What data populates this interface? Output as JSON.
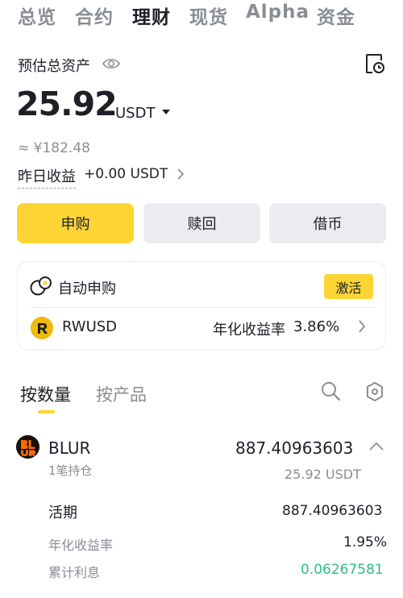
{
  "top_tabs": [
    {
      "label": "总览"
    },
    {
      "label": "合约"
    },
    {
      "label": "理财"
    },
    {
      "label": "现货"
    },
    {
      "label": "Alpha"
    },
    {
      "label": "资金"
    }
  ],
  "active_top_tab": "理财",
  "overview": {
    "label": "预估总资产",
    "balance": "25.92",
    "unit": "USDT",
    "fiat_estimate": "≈ ¥182.48",
    "yesterday_label": "昨日收益",
    "yesterday_value": "+0.00 USDT"
  },
  "actions": {
    "subscribe": "申购",
    "redeem": "赎回",
    "borrow": "借币"
  },
  "auto_subscribe": {
    "title": "自动申购",
    "activate": "激活",
    "coin": "RWUSD",
    "apr_label": "年化收益率",
    "apr_value": "3.86%"
  },
  "sort_tabs": {
    "by_amount": "按数量",
    "by_product": "按产品"
  },
  "holding": {
    "name": "BLUR",
    "amount": "887.40963603",
    "positions": "1笔持仓",
    "usdt_value": "25.92 USDT",
    "flexible_label": "活期",
    "flexible_amount": "887.40963603",
    "rate_label": "年化收益率",
    "rate_value": "1.95%",
    "interest_label": "累计利息",
    "interest_value": "0.06267581"
  },
  "colors": {
    "accent": "#fcd535",
    "positive": "#2ebd85",
    "muted": "#8a8d93"
  },
  "icons": [
    "eye-icon",
    "history-icon",
    "caret-down-icon",
    "chevron-right-icon",
    "auto-subscribe-icon",
    "rwusd-logo",
    "search-icon",
    "settings-icon",
    "blur-logo",
    "chevron-up-icon"
  ]
}
